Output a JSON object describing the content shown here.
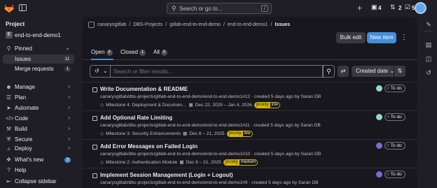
{
  "topbar": {
    "search_placeholder": "Search or go to...",
    "search_shortcut": "/",
    "issues_count": "4",
    "mr_count": "2",
    "todo_count": "5",
    "plus_icon": "plus-icon",
    "accent": "#428fdc"
  },
  "sidebar": {
    "heading": "Project",
    "project_letter": "E",
    "project_name": "end-to-end-demo1",
    "pinned_label": "Pinned",
    "items": [
      {
        "label": "Issues",
        "badge": "11"
      },
      {
        "label": "Merge requests",
        "badge": "1"
      }
    ],
    "sections": [
      {
        "label": "Manage",
        "icon": "users-icon"
      },
      {
        "label": "Plan",
        "icon": "planning-icon"
      },
      {
        "label": "Automate",
        "icon": "rocket-icon"
      },
      {
        "label": "Code",
        "icon": "code-icon"
      },
      {
        "label": "Build",
        "icon": "build-icon"
      },
      {
        "label": "Secure",
        "icon": "shield-icon"
      },
      {
        "label": "Deploy",
        "icon": "deploy-icon"
      }
    ],
    "footer": {
      "whats_new": "What's new",
      "whats_new_badge": "3",
      "help": "Help",
      "collapse": "Collapse sidebar"
    }
  },
  "breadcrumb": [
    "canarysgitlab",
    "DBS-Projects",
    "gitlab-end-to-end-demo",
    "end-to-end-demo1",
    "Issues"
  ],
  "actions": {
    "bulk_edit": "Bulk edit",
    "new_item": "New item"
  },
  "tabs": [
    {
      "label": "Open",
      "count": "8"
    },
    {
      "label": "Closed",
      "count": "1"
    },
    {
      "label": "All",
      "count": "9"
    }
  ],
  "filter": {
    "placeholder": "Search or filter results...",
    "sort_label": "Created date"
  },
  "issues": [
    {
      "title": "Write Documentation & README",
      "meta": "canarysgitlab/dbs-projects/gitlab-end-to-end-demo/end-to-end-demo1#12 · created 5 days ago by Saran DB",
      "milestone": "Milestone 4: Deployment & Documen…",
      "dates": "Dec 22, 2025 – Jan 4, 2026",
      "label_key": "priority",
      "label_value": "low",
      "state": "To do",
      "avatar_color": "#8fd8d2"
    },
    {
      "title": "Add Optional Rate Limiting",
      "meta": "canarysgitlab/dbs-projects/gitlab-end-to-end-demo/end-to-end-demo1#11 · created 5 days ago by Saran DB",
      "milestone": "Milestone 3: Security Enhancements",
      "dates": "Dec 8 – 21, 2025",
      "label_key": "priority",
      "label_value": "low",
      "state": "To do",
      "avatar_color": "#8fd8d2"
    },
    {
      "title": "Add Error Messages on Failed Login",
      "meta": "canarysgitlab/dbs-projects/gitlab-end-to-end-demo/end-to-end-demo1#10 · created 5 days ago by Saran DB",
      "milestone": "Milestone 2: Authentication Module",
      "dates": "Dec 8 – 21, 2025",
      "label_key": "priority",
      "label_value": "medium",
      "state": "To do",
      "avatar_color": "#7a6ad8"
    },
    {
      "title": "Implement Session Management (Login + Logout)",
      "meta": "canarysgitlab/dbs-projects/gitlab-end-to-end-demo/end-to-end-demo1#9 · created 5 days ago by Saran DB",
      "milestone": "",
      "dates": "",
      "label_key": "",
      "label_value": "",
      "state": "To do",
      "avatar_color": "#7a6ad8"
    }
  ]
}
